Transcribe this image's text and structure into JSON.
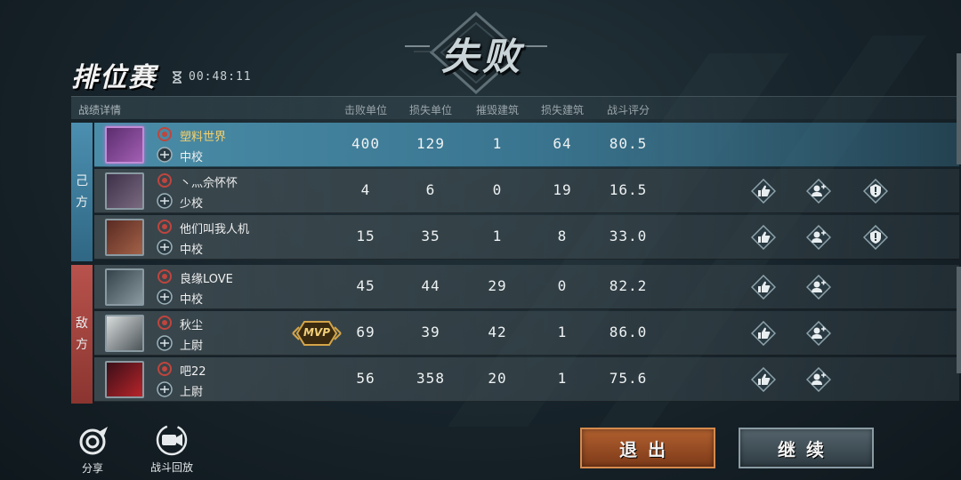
{
  "header": {
    "mode_title": "排位赛",
    "timer": "00:48:11",
    "result": "失败"
  },
  "table": {
    "caption": "战绩详情",
    "columns": [
      "击败单位",
      "损失单位",
      "摧毁建筑",
      "损失建筑",
      "战斗评分"
    ]
  },
  "sides": {
    "ally": [
      "己",
      "方"
    ],
    "enemy": [
      "敌",
      "方"
    ]
  },
  "players": [
    {
      "name": "塑料世界",
      "rank": "中校",
      "stats": [
        "400",
        "129",
        "1",
        "64",
        "80.5"
      ],
      "self": true,
      "mvp": false,
      "actions": []
    },
    {
      "name": "丶灬佘怀怀",
      "rank": "少校",
      "stats": [
        "4",
        "6",
        "0",
        "19",
        "16.5"
      ],
      "self": false,
      "mvp": false,
      "actions": [
        "like-icon",
        "add-friend-icon",
        "report-icon"
      ]
    },
    {
      "name": "他们叫我人机",
      "rank": "中校",
      "stats": [
        "15",
        "35",
        "1",
        "8",
        "33.0"
      ],
      "self": false,
      "mvp": false,
      "actions": [
        "like-icon",
        "add-friend-icon",
        "report-icon"
      ]
    },
    {
      "name": "良缘LOVE",
      "rank": "中校",
      "stats": [
        "45",
        "44",
        "29",
        "0",
        "82.2"
      ],
      "self": false,
      "mvp": false,
      "actions": [
        "like-icon",
        "add-friend-icon"
      ]
    },
    {
      "name": "秋尘",
      "rank": "上尉",
      "stats": [
        "69",
        "39",
        "42",
        "1",
        "86.0"
      ],
      "self": false,
      "mvp": true,
      "actions": [
        "like-icon",
        "add-friend-icon"
      ]
    },
    {
      "name": "吧22",
      "rank": "上尉",
      "stats": [
        "56",
        "358",
        "20",
        "1",
        "75.6"
      ],
      "self": false,
      "mvp": false,
      "actions": [
        "like-icon",
        "add-friend-icon"
      ]
    }
  ],
  "mvp_label": "MVP",
  "footer": {
    "share_label": "分享",
    "replay_label": "战斗回放",
    "exit_label": "退出",
    "continue_label": "继续"
  },
  "colors": {
    "ally": "#4c8fb0",
    "enemy": "#b8524c",
    "self_name": "#f6d06a",
    "exit_button": "#9a4b24",
    "continue_button": "#44545c"
  }
}
